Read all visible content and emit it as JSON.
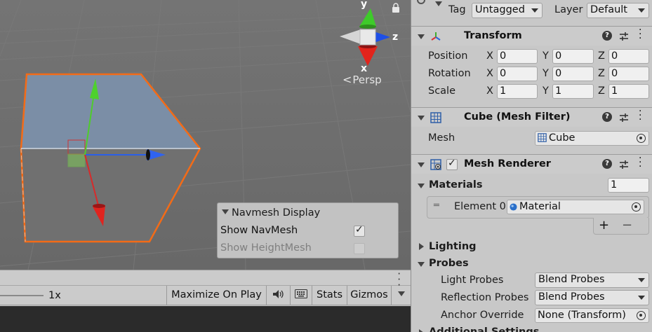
{
  "scene": {
    "gizmo": {
      "axis_y": "y",
      "axis_z": "z",
      "axis_x": "x",
      "projection": "Persp"
    },
    "navmesh_panel": {
      "title": "Navmesh Display",
      "rows": [
        {
          "label": "Show NavMesh",
          "checked": true,
          "enabled": true
        },
        {
          "label": "Show HeightMesh",
          "checked": false,
          "enabled": false
        }
      ]
    }
  },
  "game_toolbar": {
    "scale_value": "1x",
    "buttons": {
      "maximize": "Maximize On Play",
      "stats": "Stats",
      "gizmos": "Gizmos"
    }
  },
  "inspector": {
    "tag_label": "Tag",
    "tag_value": "Untagged",
    "layer_label": "Layer",
    "layer_value": "Default",
    "transform": {
      "title": "Transform",
      "rows": [
        {
          "label": "Position",
          "x": "0",
          "y": "0",
          "z": "0"
        },
        {
          "label": "Rotation",
          "x": "0",
          "y": "0",
          "z": "0"
        },
        {
          "label": "Scale",
          "x": "1",
          "y": "1",
          "z": "1"
        }
      ],
      "axis_x": "X",
      "axis_y": "Y",
      "axis_z": "Z"
    },
    "mesh_filter": {
      "title": "Cube (Mesh Filter)",
      "mesh_label": "Mesh",
      "mesh_value": "Cube"
    },
    "mesh_renderer": {
      "title": "Mesh Renderer",
      "enabled": true,
      "materials_label": "Materials",
      "materials_count": "1",
      "element_label": "Element 0",
      "element_value": "Material",
      "add": "+",
      "remove": "−",
      "lighting_label": "Lighting",
      "probes_label": "Probes",
      "light_probes_label": "Light Probes",
      "light_probes_value": "Blend Probes",
      "reflection_probes_label": "Reflection Probes",
      "reflection_probes_value": "Blend Probes",
      "anchor_override_label": "Anchor Override",
      "anchor_override_value": "None (Transform)",
      "additional_settings_label": "Additional Settings"
    }
  }
}
